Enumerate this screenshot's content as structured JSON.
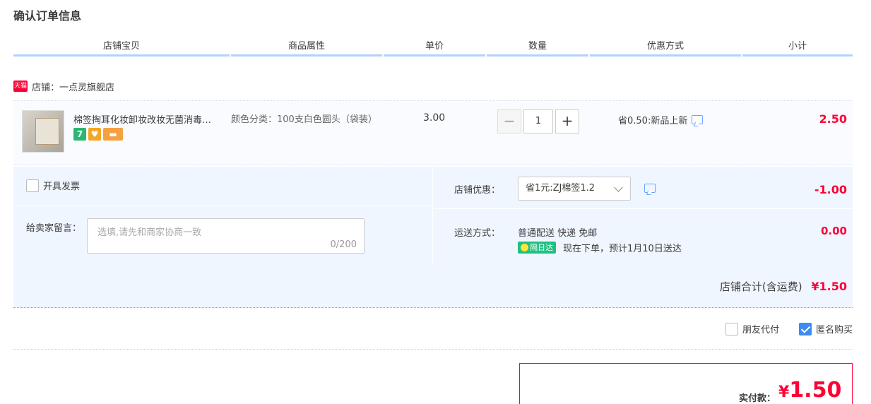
{
  "page": {
    "title": "确认订单信息"
  },
  "columns": [
    "店铺宝贝",
    "商品属性",
    "单价",
    "数量",
    "优惠方式",
    "小计"
  ],
  "shop": {
    "badge": "天猫",
    "label": "店铺：一点灵旗舰店"
  },
  "item": {
    "title": "棉签掏耳化妆卸妆改妆无菌消毒…",
    "badges": [
      "7",
      "♥",
      "▬"
    ],
    "attr": "颜色分类：100支白色圆头（袋装）",
    "price": "3.00",
    "qty": "1",
    "minus": "−",
    "plus": "+",
    "promo": "省0.50:新品上新",
    "subtotal": "2.50"
  },
  "invoice": {
    "label": "开具发票"
  },
  "message": {
    "label": "给卖家留言：",
    "placeholder": "选填,请先和商家协商一致",
    "count": "0/200"
  },
  "shop_promo": {
    "label": "店铺优惠：",
    "selected": "省1元:ZJ棉签1.2",
    "amount": "-1.00"
  },
  "shipping": {
    "label": "运送方式：",
    "method": "普通配送 快递 免邮",
    "badge": "隔日达",
    "eta": "现在下单，预计1月10日送达",
    "amount": "0.00"
  },
  "shop_total": {
    "label": "店铺合计(含运费)",
    "amount": "¥1.50"
  },
  "options": {
    "friend_pay": "朋友代付",
    "anonymous": "匿名购买"
  },
  "payment": {
    "label": "实付款：",
    "currency": "¥",
    "amount": "1.50"
  },
  "colors": {
    "accent": "#ff0036",
    "header_border": "#b2d1ff",
    "panel_bg": "#f0f6ff"
  }
}
